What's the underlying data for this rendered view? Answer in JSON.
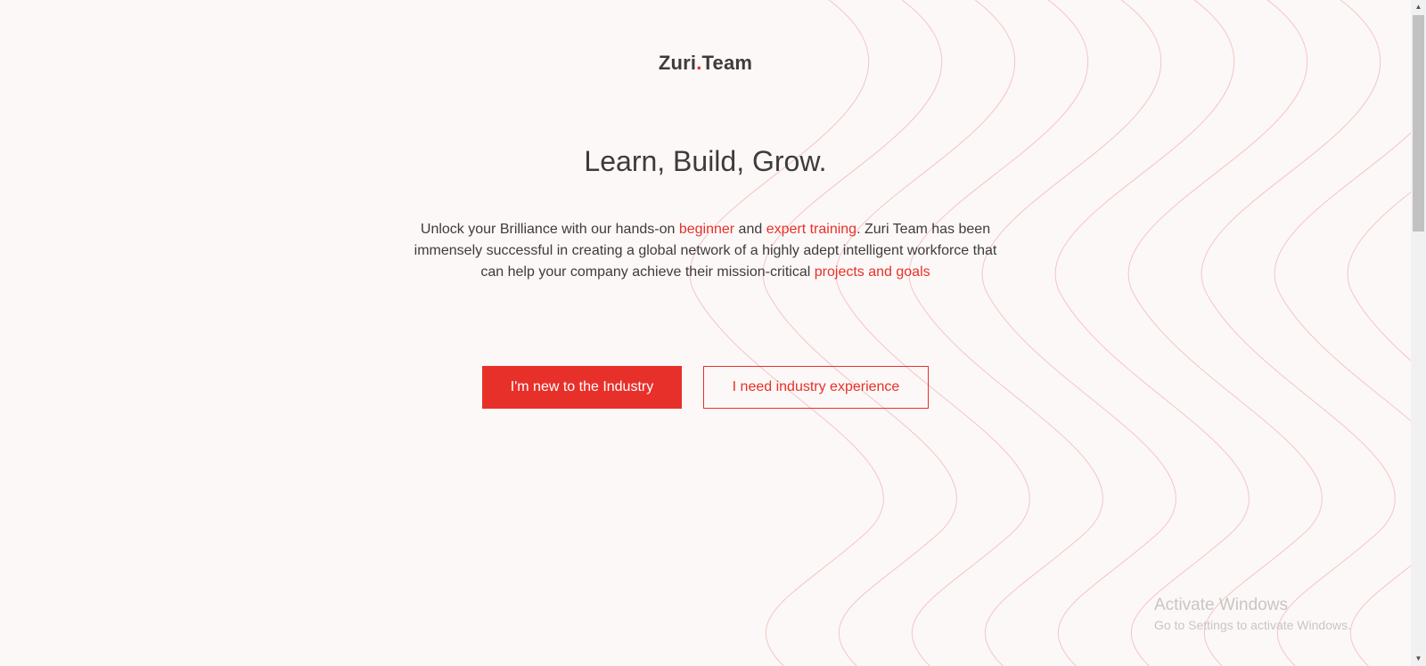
{
  "brand": {
    "name_part1": "Zuri",
    "dot": ".",
    "name_part2": "Team",
    "accent_color": "#e8302a"
  },
  "hero": {
    "headline": "Learn, Build, Grow.",
    "intro": {
      "part1": "Unlock your Brilliance with our hands-on ",
      "link1": "beginner",
      "part2": " and ",
      "link2": "expert training",
      "part3": ". Zuri Team has been immensely successful in creating a global network of a highly adept intelligent workforce that can help your company achieve their mission-critical ",
      "link3": "projects and goals"
    }
  },
  "buttons": {
    "primary": "I'm new to the Industry",
    "secondary": "I need industry experience"
  },
  "watermark": {
    "title": "Activate Windows",
    "subtitle": "Go to Settings to activate Windows."
  },
  "scrollbar": {
    "up_icon": "triangle-up-icon",
    "down_icon": "triangle-down-icon"
  }
}
